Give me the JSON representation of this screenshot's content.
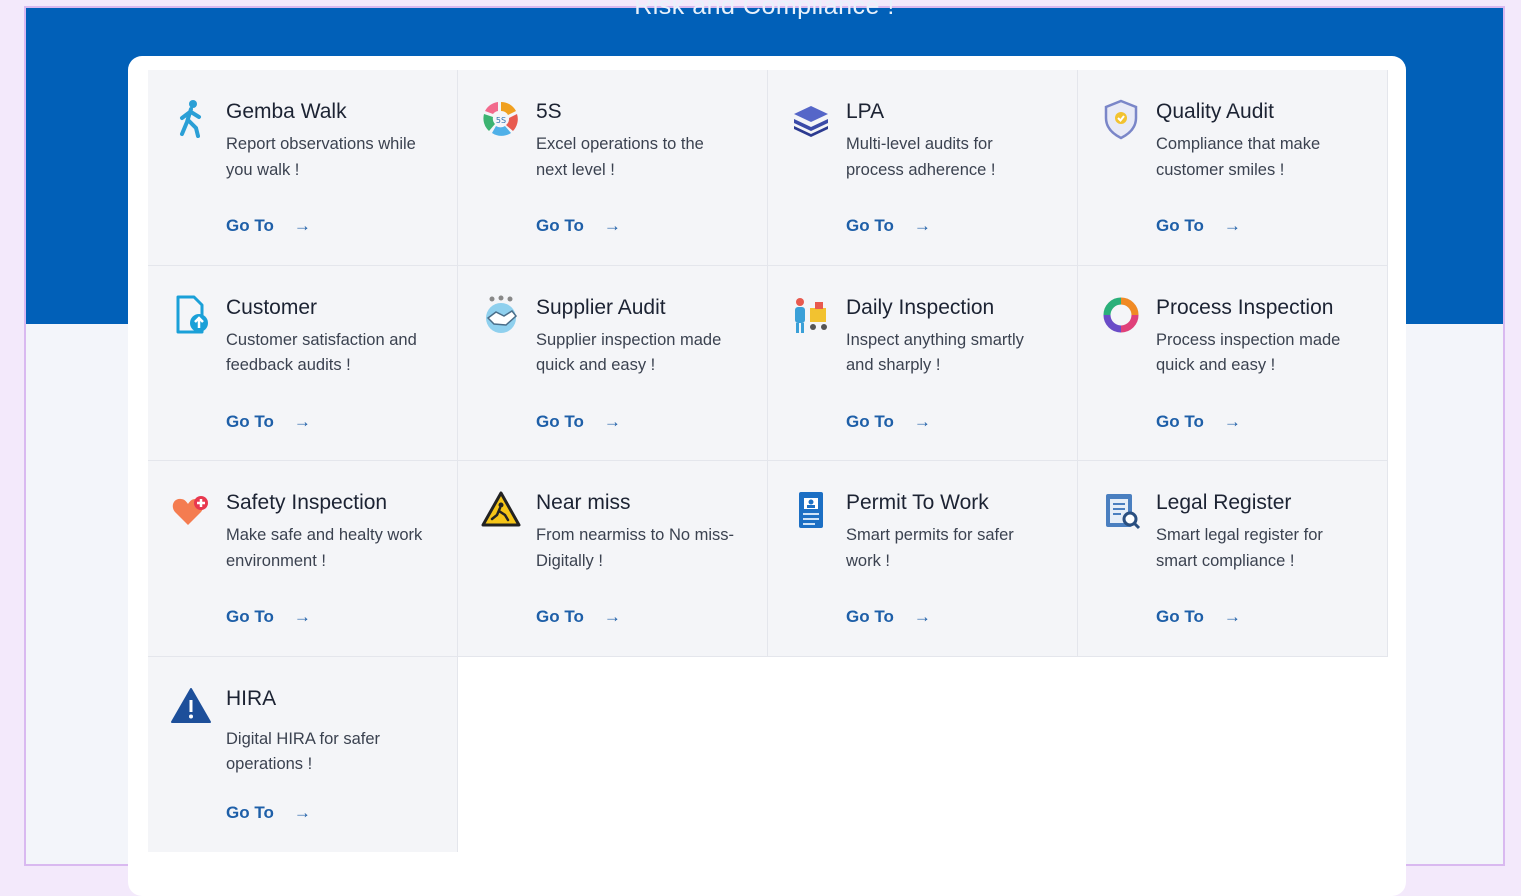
{
  "header": {
    "title": "Risk and Compliance !"
  },
  "colors": {
    "hero": "#0160b8",
    "link": "#1e5fa8",
    "card_bg": "#f4f5f8"
  },
  "cards": [
    {
      "title": "Gemba Walk",
      "desc": "Report observations while you walk !",
      "link": "Go To",
      "icon": "walking-person-icon"
    },
    {
      "title": "5S",
      "desc": "Excel operations to the next level !",
      "link": "Go To",
      "icon": "5s-cycle-icon"
    },
    {
      "title": "LPA",
      "desc": "Multi-level audits for process adherence !",
      "link": "Go To",
      "icon": "layers-icon"
    },
    {
      "title": "Quality Audit",
      "desc": "Compliance that make customer smiles !",
      "link": "Go To",
      "icon": "shield-check-icon"
    },
    {
      "title": "Customer",
      "desc": "Customer satisfaction and feedback audits !",
      "link": "Go To",
      "icon": "document-upload-icon"
    },
    {
      "title": "Supplier Audit",
      "desc": "Supplier inspection made quick and easy !",
      "link": "Go To",
      "icon": "handshake-icon"
    },
    {
      "title": "Daily Inspection",
      "desc": "Inspect anything smartly and sharply !",
      "link": "Go To",
      "icon": "worker-cart-icon"
    },
    {
      "title": "Process Inspection",
      "desc": "Process inspection made quick and easy !",
      "link": "Go To",
      "icon": "process-cycle-icon"
    },
    {
      "title": "Safety Inspection",
      "desc": "Make safe and healty work environment !",
      "link": "Go To",
      "icon": "heart-plus-icon"
    },
    {
      "title": "Near miss",
      "desc": "From nearmiss to No miss-Digitally !",
      "link": "Go To",
      "icon": "warning-slip-icon"
    },
    {
      "title": "Permit To Work",
      "desc": "Smart permits for safer work !",
      "link": "Go To",
      "icon": "permit-badge-icon"
    },
    {
      "title": "Legal Register",
      "desc": "Smart legal register for smart compliance !",
      "link": "Go To",
      "icon": "legal-document-icon"
    },
    {
      "title": "HIRA",
      "desc": "Digital HIRA for safer operations !",
      "link": "Go To",
      "icon": "warning-triangle-icon"
    }
  ]
}
